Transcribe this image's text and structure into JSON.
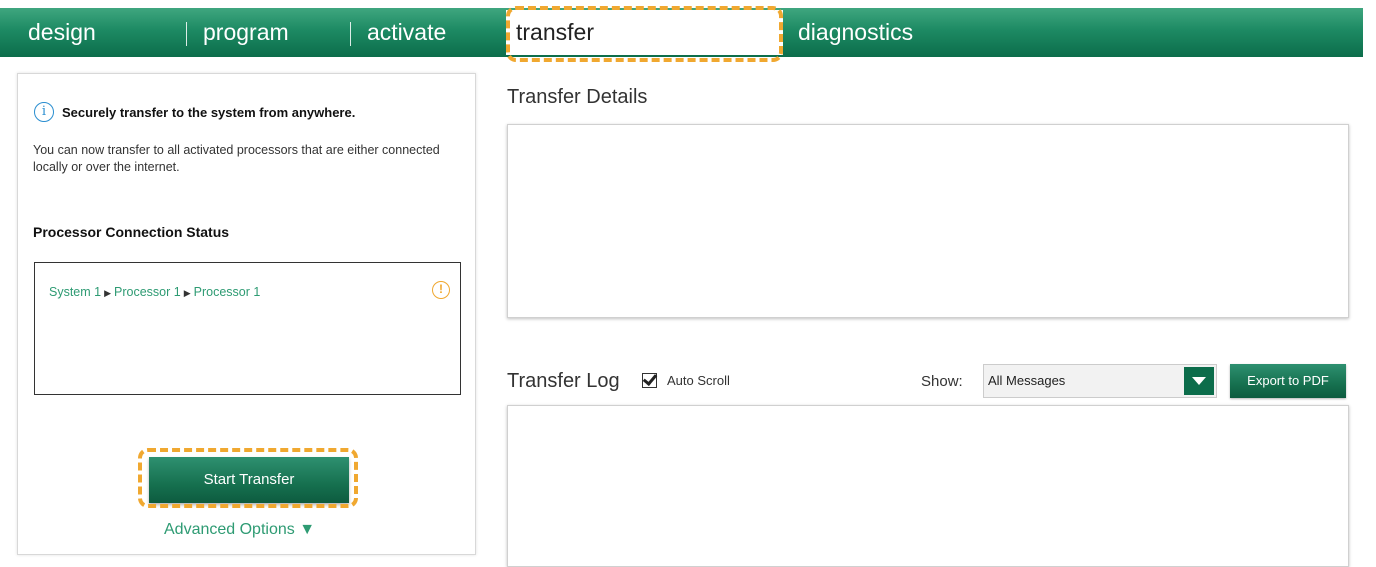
{
  "nav": {
    "tabs": [
      {
        "label": "design"
      },
      {
        "label": "program"
      },
      {
        "label": "activate"
      },
      {
        "label": "transfer",
        "active": true
      },
      {
        "label": "diagnostics"
      }
    ]
  },
  "left_panel": {
    "info_title": "Securely transfer to the system from anywhere.",
    "info_desc": "You can now transfer to all activated processors that are either connected locally or over the internet.",
    "connection_heading": "Processor Connection Status",
    "connection_path": [
      "System 1",
      "Processor 1",
      "Processor 1"
    ],
    "start_button": "Start Transfer",
    "advanced_options": "Advanced Options ▼"
  },
  "details": {
    "title": "Transfer Details"
  },
  "log": {
    "title": "Transfer Log",
    "auto_scroll_label": "Auto Scroll",
    "auto_scroll_checked": true,
    "show_label": "Show:",
    "filter_value": "All Messages",
    "export_button": "Export to PDF"
  },
  "colors": {
    "brand_green": "#0c6d4b",
    "link_green": "#2e9b73",
    "highlight_orange": "#f0a830",
    "info_blue": "#2a8ed0"
  }
}
